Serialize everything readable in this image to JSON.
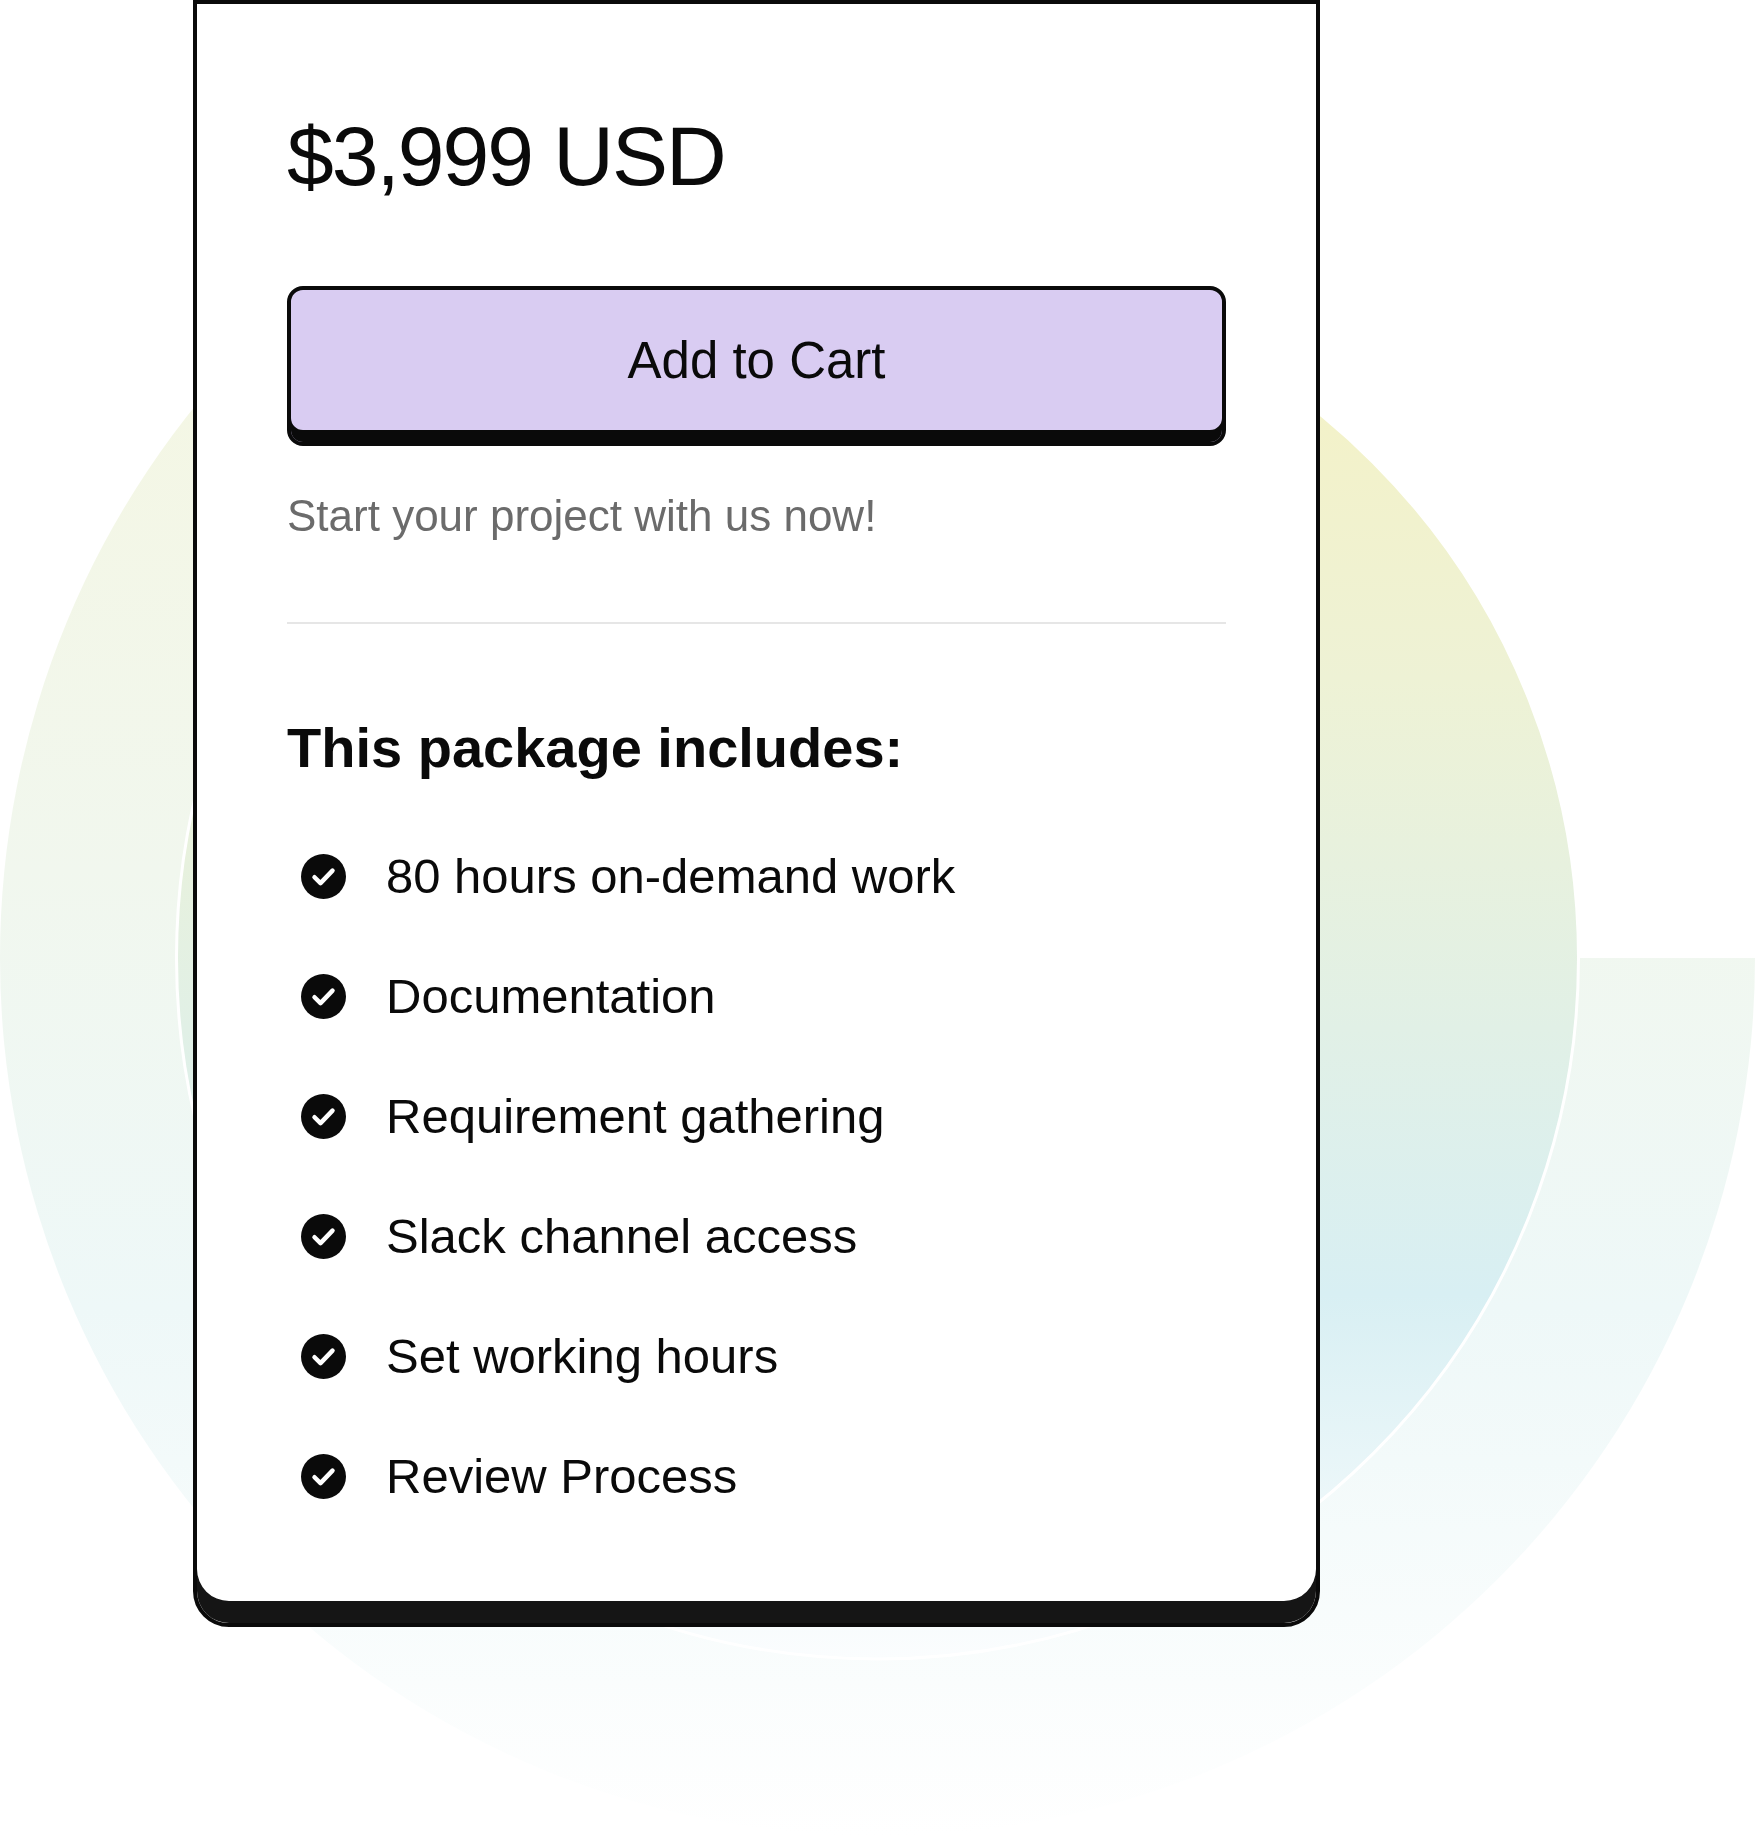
{
  "price": "$3,999 USD",
  "cta_button": {
    "label": "Add to Cart"
  },
  "tagline": "Start your project with us now!",
  "features": {
    "heading": "This package includes:",
    "items": [
      "80 hours on-demand work",
      "Documentation",
      "Requirement gathering",
      "Slack channel access",
      "Set working hours",
      "Review Process"
    ]
  }
}
